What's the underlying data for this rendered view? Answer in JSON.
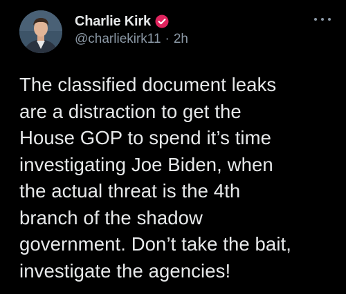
{
  "author": {
    "display_name": "Charlie Kirk",
    "handle": "@charliekirk11",
    "separator": "·",
    "time_ago": "2h",
    "verified_icon": "verified-badge-icon",
    "avatar_icon": "profile-photo"
  },
  "menu": {
    "icon": "more-options-icon"
  },
  "tweet": {
    "lines": [
      "The classified document leaks",
      "are a distraction to get the",
      "House GOP to spend it’s time",
      "investigating Joe Biden, when",
      "the actual threat is the 4th",
      "branch of the shadow",
      "government. Don’t take the bait,",
      "investigate the agencies!"
    ]
  },
  "colors": {
    "background": "#000000",
    "primary_text": "#e7e9ea",
    "secondary_text": "#8b98a5",
    "verified_badge": "#e0245e"
  }
}
